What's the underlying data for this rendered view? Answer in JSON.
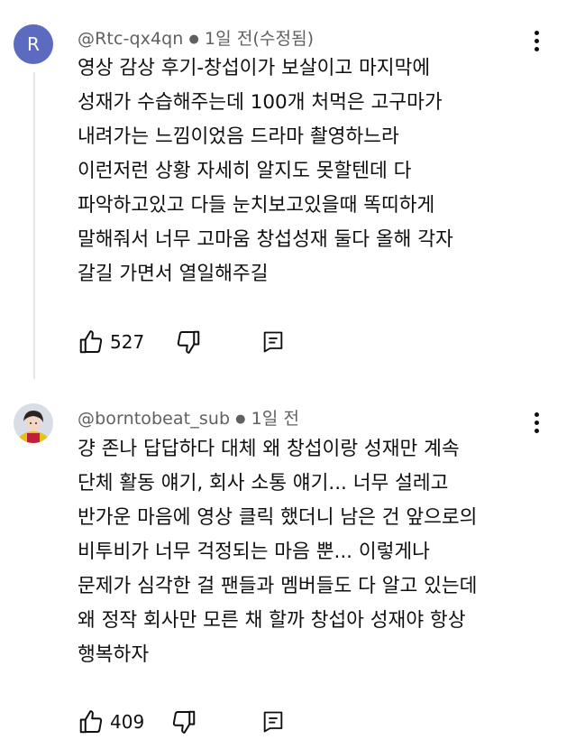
{
  "comments": [
    {
      "avatar_letter": "R",
      "avatar_color": "#5c6bc0",
      "author": "@Rtc-qx4qn",
      "time": "1일 전(수정됨)",
      "lines": [
        "영상 감상 후기-창섭이가 보살이고 마지막에",
        "성재가 수습해주는데 100개 처먹은 고구마가",
        "내려가는 느낌이었음 드라마 촬영하느라",
        "이런저런 상황 자세히 알지도 못할텐데 다",
        "파악하고있고 다들 눈치보고있을때 똑띠하게",
        "말해줘서 너무 고마움 창섭성재 둘다 올해 각자",
        "갈길 가면서 열일해주길"
      ],
      "likes": "527"
    },
    {
      "author": "@borntobeat_sub",
      "time": "1일 전",
      "lines": [
        "걍 존나 답답하다 대체 왜 창섭이랑 성재만 계속",
        "단체 활동 얘기, 회사 소통 얘기... 너무 설레고",
        "반가운 마음에 영상 클릭 했더니 남은 건 앞으로의",
        "비투비가 너무 걱정되는 마음 뿐... 이렇게나",
        "문제가 심각한 걸 팬들과 멤버들도 다 알고 있는데",
        "왜 정작 회사만 모른 채 할까 창섭아 성재야 항상",
        "행복하자"
      ],
      "likes": "409"
    }
  ],
  "icons": {
    "like": "thumb-up-outline",
    "dislike": "thumb-down-outline",
    "reply": "comment-reply",
    "more": "vertical-ellipsis"
  }
}
